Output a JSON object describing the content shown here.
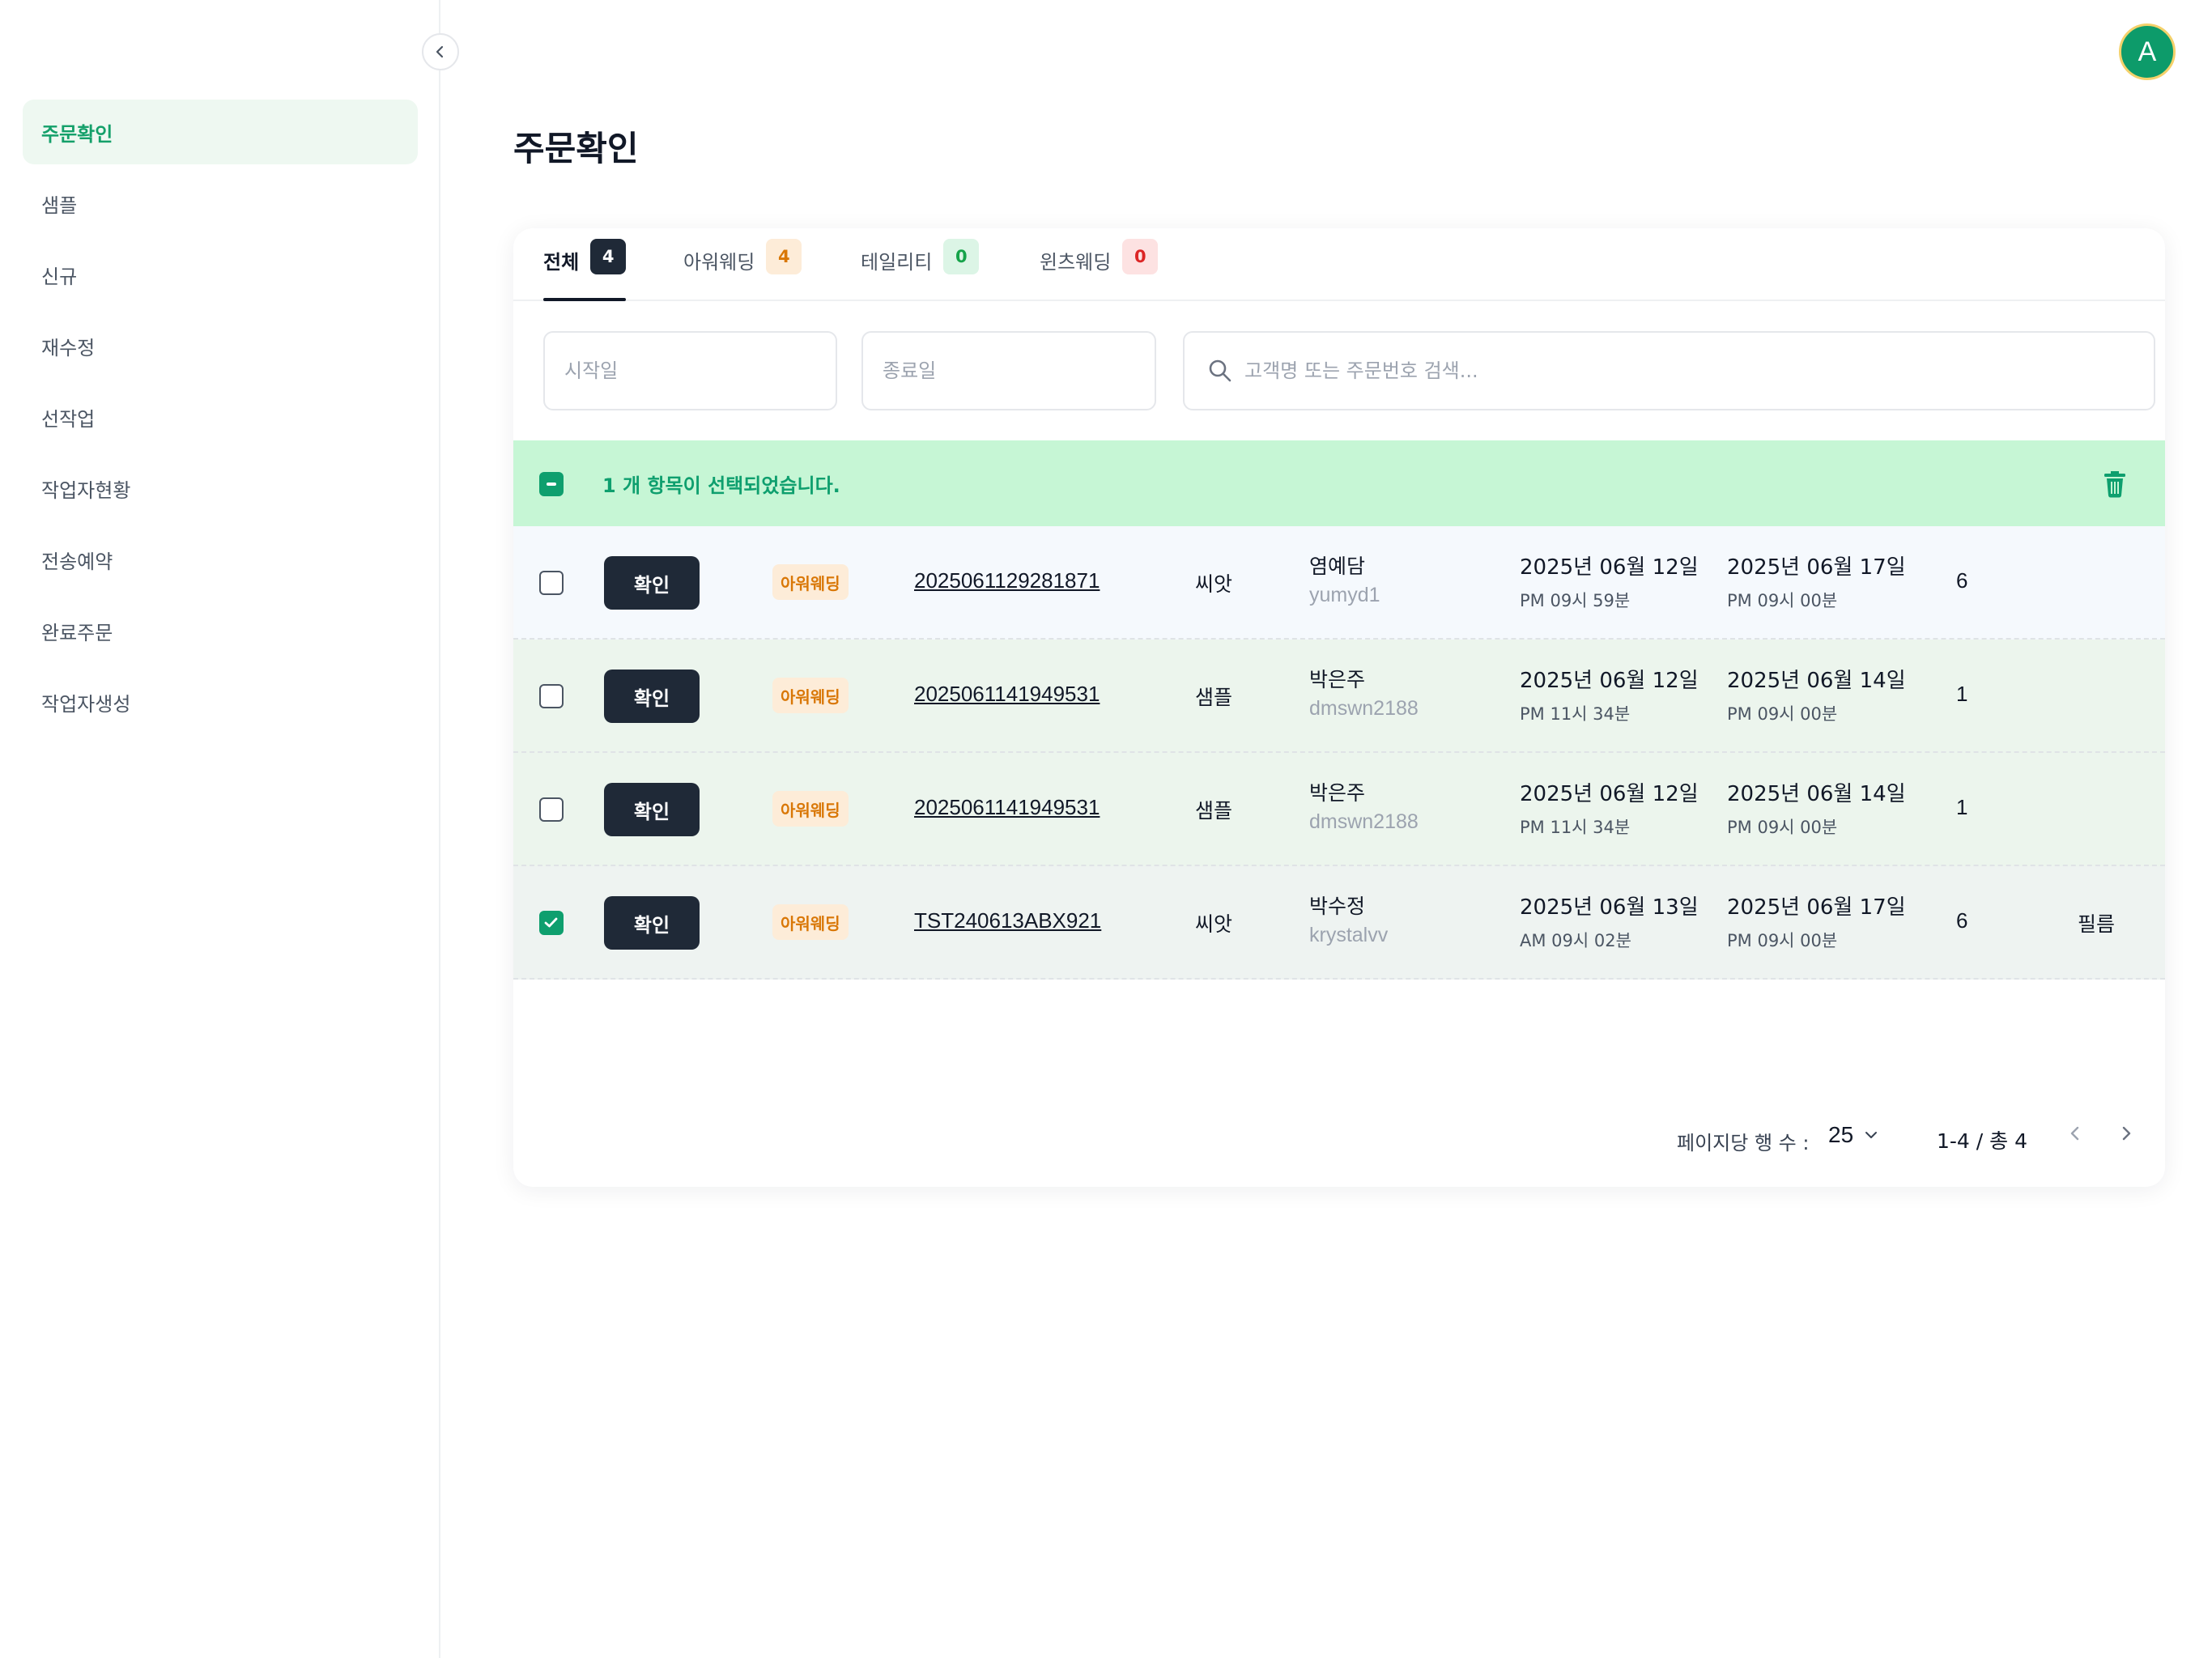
{
  "sidebar": {
    "items": [
      {
        "label": "주문확인",
        "active": true
      },
      {
        "label": "샘플"
      },
      {
        "label": "신규"
      },
      {
        "label": "재수정"
      },
      {
        "label": "선작업"
      },
      {
        "label": "작업자현황"
      },
      {
        "label": "전송예약"
      },
      {
        "label": "완료주문"
      },
      {
        "label": "작업자생성"
      }
    ]
  },
  "user": {
    "avatar_initial": "A"
  },
  "page": {
    "title": "주문확인"
  },
  "tabs": [
    {
      "label": "전체",
      "count": "4"
    },
    {
      "label": "아워웨딩",
      "count": "4"
    },
    {
      "label": "테일리티",
      "count": "0"
    },
    {
      "label": "윈츠웨딩",
      "count": "0"
    }
  ],
  "filters": {
    "start_placeholder": "시작일",
    "end_placeholder": "종료일",
    "search_placeholder": "고객명 또는 주문번호 검색..."
  },
  "selection": {
    "text": "1 개 항목이 선택되었습니다."
  },
  "rows": [
    {
      "checked": false,
      "action": "확인",
      "type": "아워웨딩",
      "order_no": "2025061129281871",
      "product": "씨앗",
      "customer_name": "염예담",
      "customer_id": "yumyd1",
      "date1": "2025년 06월 12일",
      "time1": "PM 09시 59분",
      "date2": "2025년 06월 17일",
      "time2": "PM 09시 00분",
      "qty": "6",
      "note": ""
    },
    {
      "checked": false,
      "action": "확인",
      "type": "아워웨딩",
      "order_no": "2025061141949531",
      "product": "샘플",
      "customer_name": "박은주",
      "customer_id": "dmswn2188",
      "date1": "2025년 06월 12일",
      "time1": "PM 11시 34분",
      "date2": "2025년 06월 14일",
      "time2": "PM 09시 00분",
      "qty": "1",
      "note": ""
    },
    {
      "checked": false,
      "action": "확인",
      "type": "아워웨딩",
      "order_no": "2025061141949531",
      "product": "샘플",
      "customer_name": "박은주",
      "customer_id": "dmswn2188",
      "date1": "2025년 06월 12일",
      "time1": "PM 11시 34분",
      "date2": "2025년 06월 14일",
      "time2": "PM 09시 00분",
      "qty": "1",
      "note": ""
    },
    {
      "checked": true,
      "action": "확인",
      "type": "아워웨딩",
      "order_no": "TST240613ABX921",
      "product": "씨앗",
      "customer_name": "박수정",
      "customer_id": "krystalvv",
      "date1": "2025년 06월 13일",
      "time1": "AM 09시 02분",
      "date2": "2025년 06월 17일",
      "time2": "PM 09시 00분",
      "qty": "6",
      "note": "필름"
    }
  ],
  "pagination": {
    "rows_label": "페이지당 행 수 :",
    "rows_per_page": "25",
    "range": "1-4 / 총 4"
  },
  "colors": {
    "accent": "#0e9f6e",
    "selection_bg": "#c6f6d5",
    "dark_button": "#1f2937",
    "tag_bg": "#fdecd8",
    "tag_text": "#d97706"
  }
}
